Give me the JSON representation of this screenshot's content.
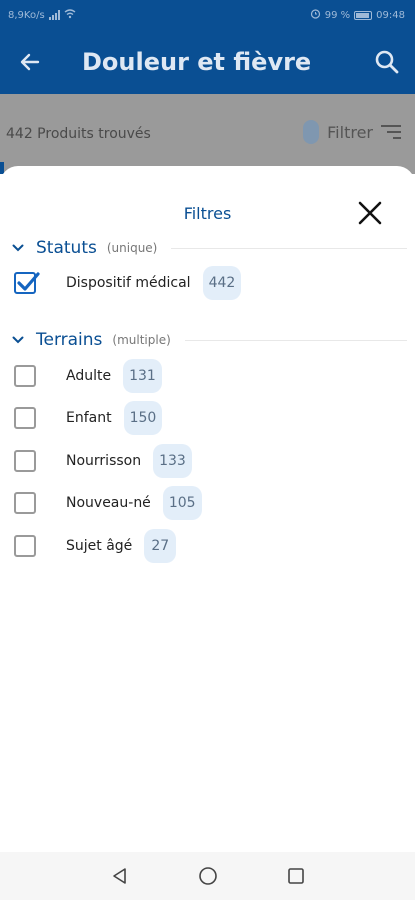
{
  "status_bar": {
    "left_text": "8,9Ko/s",
    "right_text": "99 %",
    "time": "09:48"
  },
  "app_bar": {
    "title": "Douleur et fièvre",
    "back_icon": "arrow-left-icon",
    "search_icon": "search-icon",
    "background": "#0a4f93"
  },
  "background_page": {
    "results_text": "442 Produits trouvés",
    "filter_label": "Filtrer",
    "filter_icon": "filter-lines-icon"
  },
  "sheet": {
    "title": "Filtres",
    "close_icon": "close-icon",
    "sections": [
      {
        "name": "Statuts",
        "hint": "(unique)",
        "options": [
          {
            "label": "Dispositif médical",
            "count": "442",
            "checked": true
          }
        ]
      },
      {
        "name": "Terrains",
        "hint": "(multiple)",
        "options": [
          {
            "label": "Adulte",
            "count": "131",
            "checked": false
          },
          {
            "label": "Enfant",
            "count": "150",
            "checked": false
          },
          {
            "label": "Nourrisson",
            "count": "133",
            "checked": false
          },
          {
            "label": "Nouveau-né",
            "count": "105",
            "checked": false
          },
          {
            "label": "Sujet âgé",
            "count": "27",
            "checked": false
          }
        ]
      }
    ]
  },
  "nav_bar": {
    "icons": [
      "nav-back-triangle-icon",
      "nav-home-circle-icon",
      "nav-recents-square-icon"
    ]
  },
  "colors": {
    "primary": "#0a4f93",
    "accent_check": "#1565c0",
    "badge_bg": "#e3eef9"
  }
}
